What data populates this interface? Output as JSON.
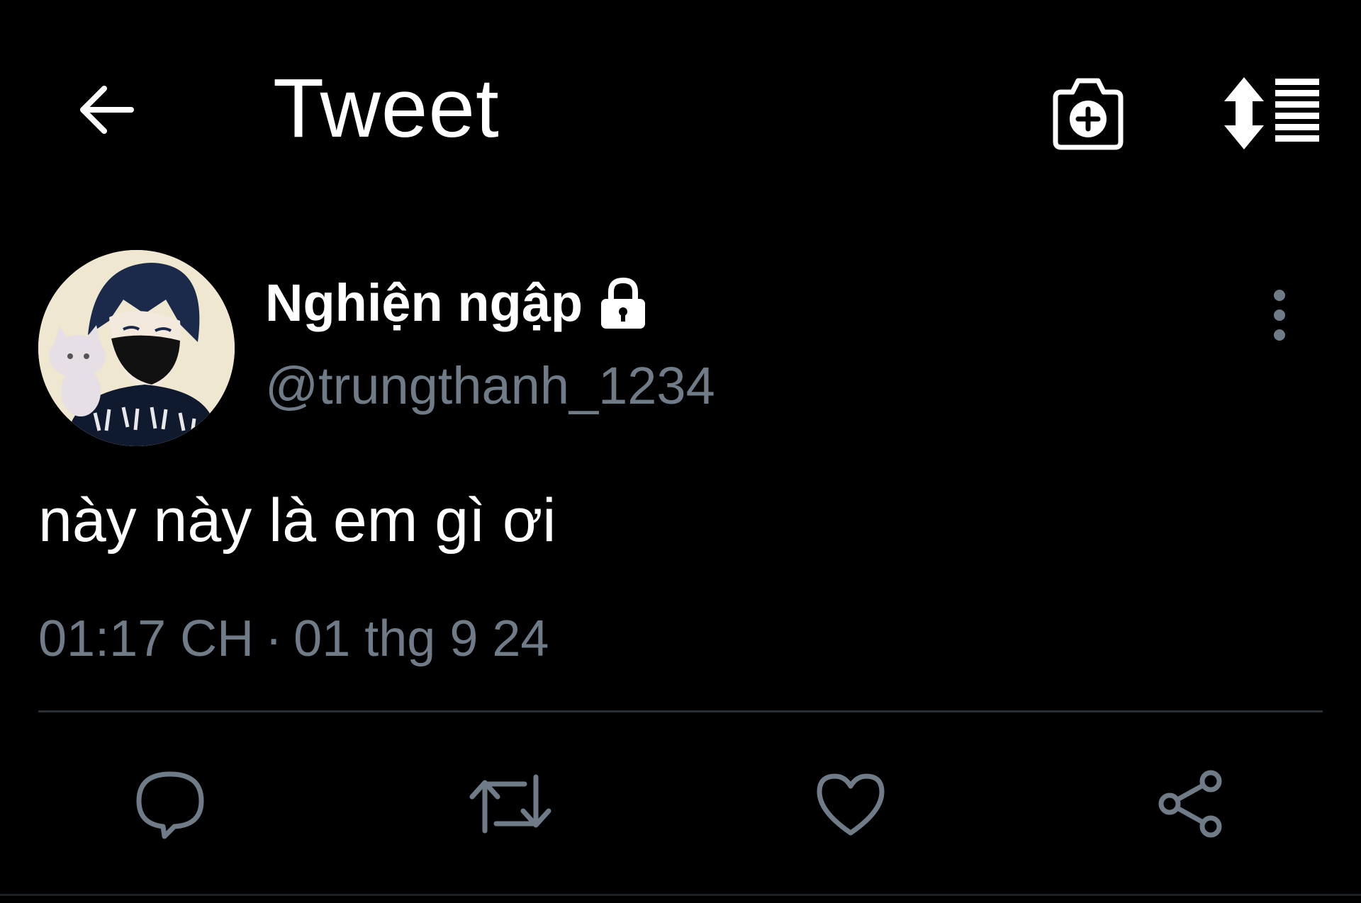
{
  "header": {
    "title": "Tweet",
    "back_icon": "arrow-left-icon",
    "camera_icon": "camera-add-icon",
    "sort_icon": "sort-list-icon"
  },
  "tweet": {
    "author_name": "Nghiện ngập",
    "author_handle": "@trungthanh_1234",
    "locked": true,
    "text": "này này là em gì ơi",
    "time": "01:17 CH",
    "separator": "·",
    "date": "01 thg 9 24"
  },
  "actions": [
    {
      "name": "reply",
      "icon": "reply-bubble-icon"
    },
    {
      "name": "retweet",
      "icon": "retweet-icon"
    },
    {
      "name": "like",
      "icon": "heart-icon"
    },
    {
      "name": "share",
      "icon": "share-icon"
    }
  ],
  "colors": {
    "background": "#000000",
    "primary_text": "#ffffff",
    "secondary_text": "#6f7c87",
    "icon_gray": "#6f7c87",
    "divider": "#2a2f33"
  }
}
